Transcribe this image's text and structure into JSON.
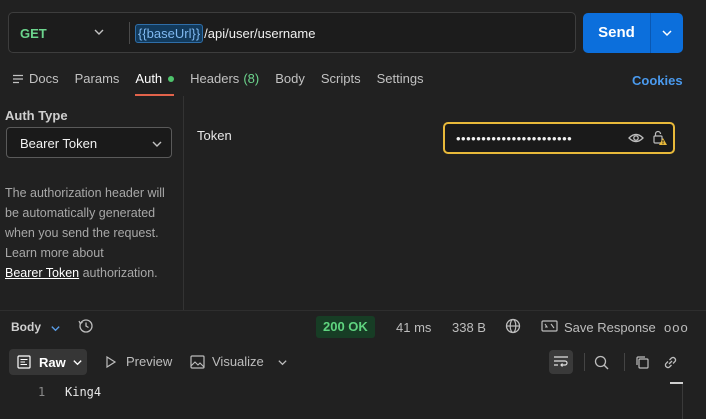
{
  "request": {
    "method": "GET",
    "url_variable": "{{baseUrl}}",
    "url_path": "/api/user/username",
    "send_label": "Send"
  },
  "tabs": {
    "docs": "Docs",
    "params": "Params",
    "auth": "Auth",
    "headers": "Headers",
    "headers_count": "(8)",
    "body": "Body",
    "scripts": "Scripts",
    "settings": "Settings",
    "cookies": "Cookies"
  },
  "auth": {
    "type_label": "Auth Type",
    "type_value": "Bearer Token",
    "description": "The authorization header will be automatically generated when you send the request. Learn more about",
    "link_text": "Bearer Token",
    "link_suffix": "authorization.",
    "token_label": "Token",
    "token_masked": "•••••••••••••••••••••••"
  },
  "response": {
    "body_label": "Body",
    "status": "200 OK",
    "time": "41 ms",
    "size": "338 B",
    "save_label": "Save Response",
    "more": "ooo",
    "format_label": "Raw",
    "preview_label": "Preview",
    "visualize_label": "Visualize",
    "lines": [
      {
        "number": "1",
        "text": "King4"
      }
    ]
  },
  "colors": {
    "accent": "#0c6fdc",
    "method_get": "#6cd48d",
    "active_tab_underline": "#e2634b",
    "warning_border": "#e8b93a",
    "status_ok": "#5fd47f"
  },
  "icons": [
    "chevron-down-icon",
    "docs-icon",
    "history-icon",
    "globe-icon",
    "save-icon",
    "raw-icon",
    "play-icon",
    "image-icon",
    "wrap-icon",
    "search-icon",
    "copy-icon",
    "link-icon",
    "eye-icon",
    "lock-warning-icon"
  ]
}
